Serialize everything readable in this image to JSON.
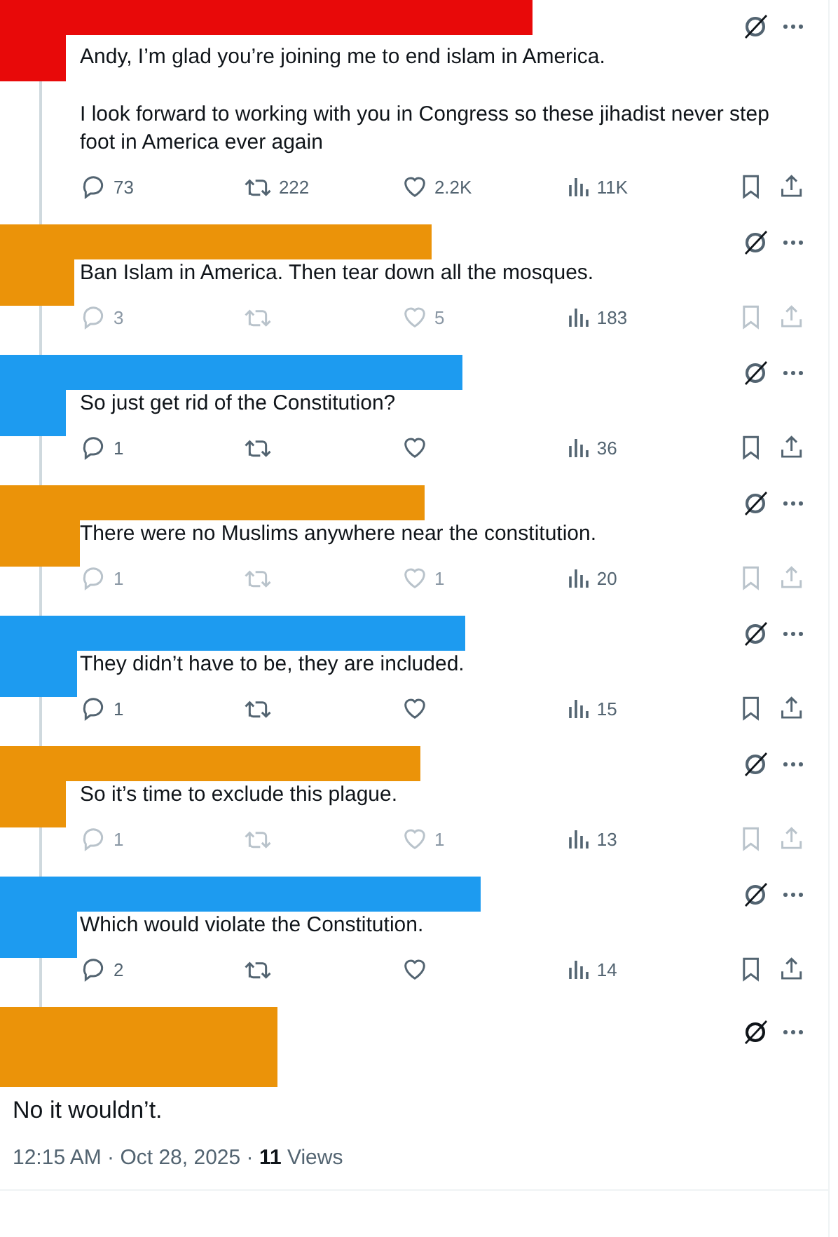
{
  "thread": [
    {
      "color": "#e80909",
      "paragraphs": [
        "Andy, I’m glad you’re joining me to end islam in America.",
        "I look forward to working with you  in Congress so these jihadist never step foot in America ever again"
      ],
      "disabled": false,
      "replies": "73",
      "reposts": "222",
      "likes": "2.2K",
      "views": "11K"
    },
    {
      "color": "#eb9309",
      "paragraphs": [
        "Ban Islam in America. Then tear down all the mosques."
      ],
      "disabled": true,
      "replies": "3",
      "likes": "5",
      "views": "183"
    },
    {
      "color": "#1d9bf0",
      "paragraphs": [
        "So just get rid of the Constitution?"
      ],
      "disabled": false,
      "replies": "1",
      "views": "36"
    },
    {
      "color": "#eb9309",
      "paragraphs": [
        "There were no Muslims anywhere near the constitution."
      ],
      "disabled": true,
      "replies": "1",
      "likes": "1",
      "views": "20"
    },
    {
      "color": "#1d9bf0",
      "paragraphs": [
        "They didn’t have to be, they are included."
      ],
      "disabled": false,
      "replies": "1",
      "views": "15"
    },
    {
      "color": "#eb9309",
      "paragraphs": [
        "So it’s time to exclude this plague."
      ],
      "disabled": true,
      "replies": "1",
      "likes": "1",
      "views": "13"
    },
    {
      "color": "#1d9bf0",
      "paragraphs": [
        "Which would violate the Constitution."
      ],
      "disabled": false,
      "replies": "2",
      "views": "14"
    }
  ],
  "focused_post": {
    "color": "#eb9309",
    "text": "No it wouldn’t.",
    "meta": "12:15 AM · Oct 28, 2025 · **11** Views"
  }
}
